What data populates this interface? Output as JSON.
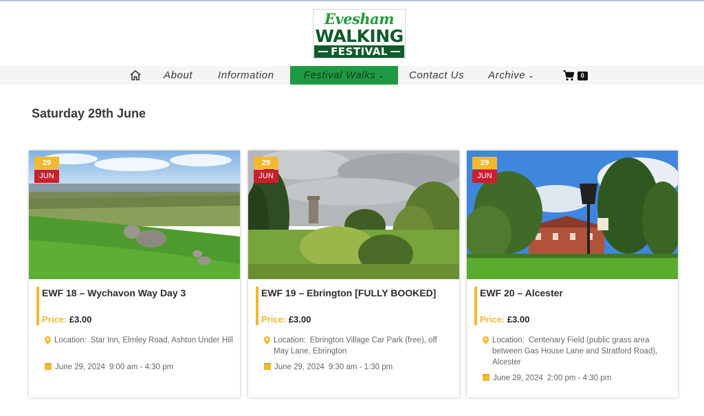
{
  "logo": {
    "line1": "Evesham",
    "line2": "WALKING",
    "line3": "FESTIVAL"
  },
  "nav": {
    "home_icon": "home-icon",
    "items": [
      "About",
      "Information",
      "Festival Walks",
      "Contact Us",
      "Archive"
    ],
    "active": "Festival Walks",
    "cart_icon": "cart-icon",
    "cart_count": "0",
    "accent_color": "#1e9a44"
  },
  "heading": "Saturday 29th June",
  "colors": {
    "date_day_bg": "#f2b92f",
    "date_month_bg": "#c8202d",
    "price_label": "#f2b92f"
  },
  "events": [
    {
      "day": "29",
      "month": "JUN",
      "title": "EWF 18 – Wychavon Way Day 3",
      "price_label": "Price:",
      "price": "£3.00",
      "location_label": "Location:",
      "location": "Star Inn, Elmley Road, Ashton Under Hill",
      "date": "June 29, 2024",
      "time": "9:00 am - 4:30 pm"
    },
    {
      "day": "29",
      "month": "JUN",
      "title": "EWF 19 – Ebrington [FULLY BOOKED]",
      "price_label": "Price:",
      "price": "£3.00",
      "location_label": "Location:",
      "location": "Ebrington Village Car Park (free), off May Lane, Ebrington",
      "date": "June 29, 2024",
      "time": "9:30 am - 1:30 pm"
    },
    {
      "day": "29",
      "month": "JUN",
      "title": "EWF 20 – Alcester",
      "price_label": "Price:",
      "price": "£3.00",
      "location_label": "Location:",
      "location": "Centenary Field (public grass area between Gas House Lane and Stratford Road), Alcester",
      "date": "June 29, 2024",
      "time": "2:00 pm - 4:30 pm"
    }
  ]
}
